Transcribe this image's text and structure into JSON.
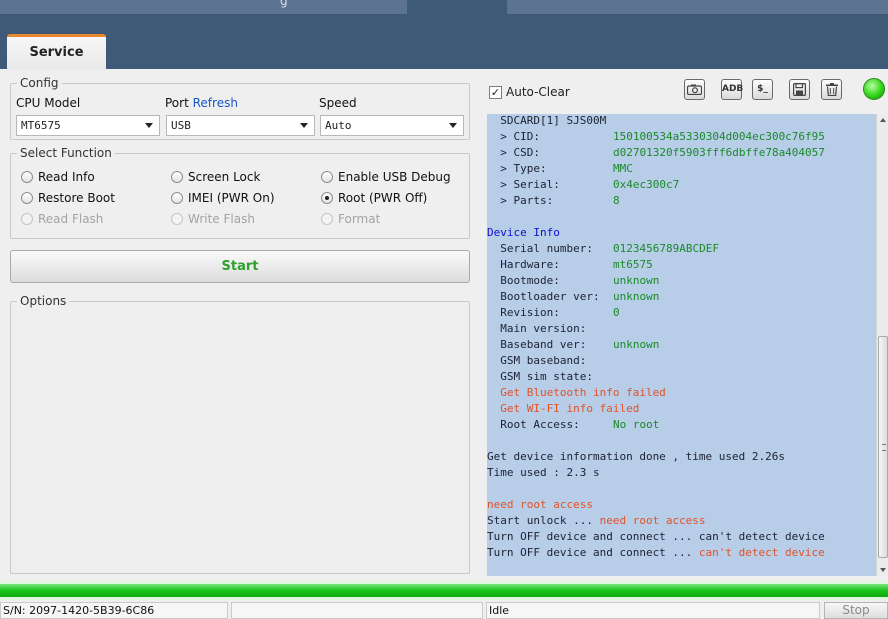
{
  "tabs": [
    {
      "label": "Service",
      "active": true
    }
  ],
  "config": {
    "title": "Config",
    "cpu_model": {
      "label": "CPU Model",
      "value": "MT6575"
    },
    "port": {
      "label": "Port",
      "refresh_label": "Refresh",
      "value": "USB"
    },
    "speed": {
      "label": "Speed",
      "value": "Auto"
    }
  },
  "select_function": {
    "title": "Select Function",
    "options": [
      {
        "label": "Read Info",
        "checked": false,
        "disabled": false
      },
      {
        "label": "Screen Lock",
        "checked": false,
        "disabled": false
      },
      {
        "label": "Enable USB Debug",
        "checked": false,
        "disabled": false
      },
      {
        "label": "Restore Boot",
        "checked": false,
        "disabled": false
      },
      {
        "label": "IMEI (PWR On)",
        "checked": false,
        "disabled": false
      },
      {
        "label": "Root (PWR Off)",
        "checked": true,
        "disabled": false
      },
      {
        "label": "Read Flash",
        "checked": false,
        "disabled": true
      },
      {
        "label": "Write Flash",
        "checked": false,
        "disabled": true
      },
      {
        "label": "Format",
        "checked": false,
        "disabled": true
      }
    ]
  },
  "start_label": "Start",
  "options_title": "Options",
  "auto_clear": {
    "label": "Auto-Clear",
    "checked": true,
    "check_glyph": "✓"
  },
  "toolbar": {
    "adb_label": "ADB",
    "shell_label": "$_"
  },
  "log": {
    "lines": [
      [
        "  SDCARD[1] SJS00M",
        "k",
        "",
        ""
      ],
      [
        "  > CID:",
        "k",
        "150100534a5330304d004ec300c76f95",
        "v"
      ],
      [
        "  > CSD:",
        "k",
        "d02701320f5903fff6dbffe78a404057",
        "v"
      ],
      [
        "  > Type:",
        "k",
        "MMC",
        "v"
      ],
      [
        "  > Serial:",
        "k",
        "0x4ec300c7",
        "v"
      ],
      [
        "  > Parts:",
        "k",
        "8",
        "v"
      ],
      [
        "",
        "k",
        "",
        ""
      ],
      [
        "Device Info",
        "h",
        "",
        ""
      ],
      [
        "  Serial number:",
        "k",
        "0123456789ABCDEF",
        "v"
      ],
      [
        "  Hardware:",
        "k",
        "mt6575",
        "v"
      ],
      [
        "  Bootmode:",
        "k",
        "unknown",
        "v"
      ],
      [
        "  Bootloader ver:",
        "k",
        "unknown",
        "v"
      ],
      [
        "  Revision:",
        "k",
        "0",
        "v"
      ],
      [
        "  Main version:",
        "k",
        "",
        ""
      ],
      [
        "  Baseband ver:",
        "k",
        "unknown",
        "v"
      ],
      [
        "  GSM baseband:",
        "k",
        "",
        ""
      ],
      [
        "  GSM sim state:",
        "k",
        "",
        ""
      ],
      [
        "  Get Bluetooth info failed",
        "e",
        "",
        ""
      ],
      [
        "  Get WI-FI info failed",
        "e",
        "",
        ""
      ],
      [
        "  Root Access:",
        "k",
        "No root",
        "v"
      ],
      [
        "",
        "k",
        "",
        ""
      ],
      [
        "Get device information done , time used 2.26s",
        "k",
        "",
        ""
      ],
      [
        "Time used : 2.3 s",
        "k",
        "",
        ""
      ],
      [
        "",
        "k",
        "",
        ""
      ],
      [
        "need root access",
        "e",
        "",
        ""
      ],
      [
        "Start unlock ... ",
        "k",
        "need root access",
        "e"
      ],
      [
        "Turn OFF device and connect ... can't detect device",
        "k",
        "",
        ""
      ],
      [
        "Turn OFF device and connect ... ",
        "k",
        "can't detect device",
        "e"
      ]
    ]
  },
  "progress": 1.0,
  "status_bar": {
    "serial": "S/N: 2097-1420-5B39-6C86",
    "middle": "",
    "state": "Idle",
    "stop_label": "Stop"
  },
  "top_glyph": "g"
}
